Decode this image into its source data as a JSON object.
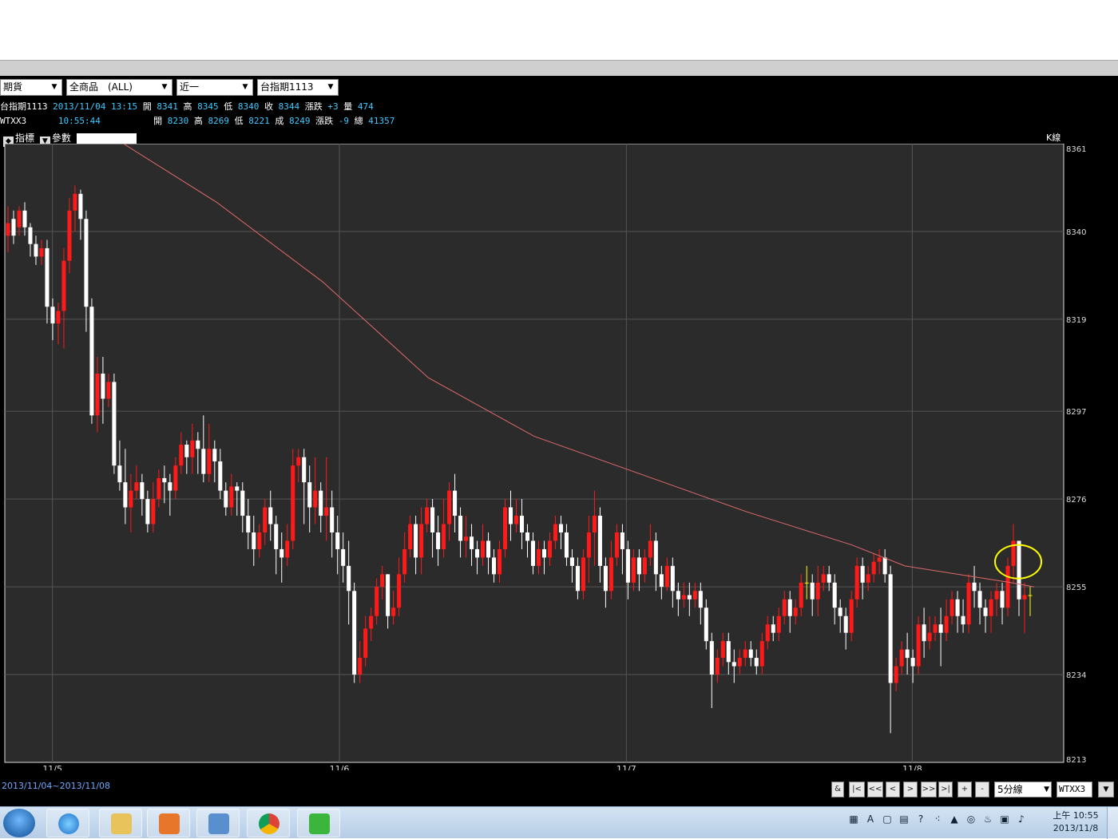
{
  "toolbar": {
    "type_select": "期貨",
    "product_select": "全商品　(ALL)",
    "month_select": "近一",
    "symbol_select": "台指期1113"
  },
  "quote1": {
    "name": "台指期1113",
    "date": "2013/11/04",
    "time": "13:15",
    "open_label": "開",
    "open": "8341",
    "high_label": "高",
    "high": "8345",
    "low_label": "低",
    "low": "8340",
    "close_label": "收",
    "close": "8344",
    "change_label": "漲跌",
    "change": "+3",
    "vol_label": "量",
    "vol": "474"
  },
  "quote2": {
    "name": "WTXX3",
    "time": "10:55:44",
    "open_label": "開",
    "open": "8230",
    "high_label": "高",
    "high": "8269",
    "low_label": "低",
    "low": "8221",
    "close_label": "成",
    "close": "8249",
    "change_label": "漲跌",
    "change": "-9",
    "vol_label": "總",
    "vol": "41357"
  },
  "indicator_bar": {
    "indicator_label": "指標",
    "params_label": "參數"
  },
  "kline_label": "K線",
  "range_label": "2013/11/04~2013/11/08",
  "nav": {
    "buttons": [
      "&",
      "|<",
      "<<",
      "<",
      ">",
      ">>",
      ">|",
      "+",
      "-"
    ]
  },
  "period_select": "5分線",
  "code_field": "WTXX3",
  "taskbar": {
    "clock_time": "上午 10:55",
    "clock_date": "2013/11/8",
    "apps": [
      "explorer",
      "ie",
      "folder",
      "media",
      "tool",
      "chrome",
      "line"
    ]
  },
  "colors": {
    "up": "#ff1a1a",
    "down": "#ffffff",
    "doji": "#ffff00",
    "ma": "#e06a6a",
    "panel": "#2b2b2b",
    "highlight": "#ffff00"
  },
  "chart_data": {
    "type": "candlestick",
    "ylim": [
      8213,
      8361
    ],
    "yticks": [
      8361,
      8340,
      8319,
      8297,
      8276,
      8255,
      8234,
      8213
    ],
    "xticks": [
      "11/5",
      "11/6",
      "11/7",
      "11/8"
    ],
    "last_close": 8253,
    "candles": [
      [
        8339,
        8342,
        8335,
        8346
      ],
      [
        8343,
        8339,
        8337,
        8345
      ],
      [
        8341,
        8345,
        8339,
        8346
      ],
      [
        8345,
        8341,
        8339,
        8347
      ],
      [
        8341,
        8337,
        8334,
        8342
      ],
      [
        8337,
        8334,
        8332,
        8339
      ],
      [
        8334,
        8336,
        8332,
        8338
      ],
      [
        8336,
        8322,
        8318,
        8338
      ],
      [
        8322,
        8318,
        8314,
        8324
      ],
      [
        8318,
        8321,
        8313,
        8323
      ],
      [
        8321,
        8333,
        8312,
        8336
      ],
      [
        8333,
        8345,
        8330,
        8348
      ],
      [
        8345,
        8349,
        8340,
        8351
      ],
      [
        8349,
        8343,
        8338,
        8350
      ],
      [
        8343,
        8322,
        8316,
        8345
      ],
      [
        8322,
        8296,
        8294,
        8324
      ],
      [
        8296,
        8306,
        8292,
        8310
      ],
      [
        8306,
        8300,
        8294,
        8310
      ],
      [
        8300,
        8304,
        8298,
        8306
      ],
      [
        8304,
        8284,
        8282,
        8306
      ],
      [
        8284,
        8280,
        8278,
        8290
      ],
      [
        8280,
        8274,
        8270,
        8288
      ],
      [
        8274,
        8278,
        8268,
        8282
      ],
      [
        8278,
        8280,
        8276,
        8284
      ],
      [
        8280,
        8276,
        8272,
        8282
      ],
      [
        8276,
        8270,
        8268,
        8278
      ],
      [
        8270,
        8276,
        8268,
        8280
      ],
      [
        8276,
        8281,
        8274,
        8283
      ],
      [
        8281,
        8280,
        8275,
        8284
      ],
      [
        8280,
        8278,
        8272,
        8282
      ],
      [
        8278,
        8284,
        8276,
        8286
      ],
      [
        8284,
        8289,
        8282,
        8292
      ],
      [
        8289,
        8286,
        8282,
        8290
      ],
      [
        8286,
        8290,
        8282,
        8294
      ],
      [
        8290,
        8288,
        8282,
        8292
      ],
      [
        8288,
        8282,
        8280,
        8296
      ],
      [
        8282,
        8288,
        8280,
        8294
      ],
      [
        8288,
        8285,
        8280,
        8290
      ],
      [
        8285,
        8278,
        8276,
        8288
      ],
      [
        8278,
        8274,
        8272,
        8280
      ],
      [
        8274,
        8279,
        8272,
        8282
      ],
      [
        8279,
        8278,
        8272,
        8280
      ],
      [
        8278,
        8272,
        8268,
        8280
      ],
      [
        8272,
        8268,
        8264,
        8276
      ],
      [
        8268,
        8264,
        8260,
        8272
      ],
      [
        8264,
        8268,
        8262,
        8270
      ],
      [
        8268,
        8274,
        8265,
        8276
      ],
      [
        8274,
        8270,
        8266,
        8278
      ],
      [
        8270,
        8264,
        8258,
        8272
      ],
      [
        8264,
        8262,
        8256,
        8268
      ],
      [
        8262,
        8266,
        8260,
        8270
      ],
      [
        8266,
        8284,
        8264,
        8288
      ],
      [
        8284,
        8286,
        8280,
        8288
      ],
      [
        8286,
        8280,
        8270,
        8288
      ],
      [
        8280,
        8274,
        8268,
        8284
      ],
      [
        8274,
        8278,
        8270,
        8286
      ],
      [
        8278,
        8272,
        8268,
        8280
      ],
      [
        8272,
        8274,
        8266,
        8286
      ],
      [
        8274,
        8268,
        8262,
        8278
      ],
      [
        8268,
        8264,
        8258,
        8272
      ],
      [
        8264,
        8260,
        8256,
        8268
      ],
      [
        8260,
        8254,
        8246,
        8266
      ],
      [
        8254,
        8234,
        8232,
        8256
      ],
      [
        8234,
        8238,
        8232,
        8242
      ],
      [
        8238,
        8245,
        8236,
        8248
      ],
      [
        8245,
        8248,
        8242,
        8250
      ],
      [
        8248,
        8255,
        8246,
        8257
      ],
      [
        8255,
        8258,
        8252,
        8260
      ],
      [
        8258,
        8248,
        8245,
        8258
      ],
      [
        8248,
        8250,
        8246,
        8254
      ],
      [
        8250,
        8258,
        8248,
        8262
      ],
      [
        8258,
        8264,
        8256,
        8268
      ],
      [
        8264,
        8270,
        8262,
        8272
      ],
      [
        8270,
        8262,
        8258,
        8272
      ],
      [
        8262,
        8270,
        8258,
        8274
      ],
      [
        8270,
        8274,
        8268,
        8276
      ],
      [
        8274,
        8268,
        8262,
        8276
      ],
      [
        8268,
        8264,
        8260,
        8272
      ],
      [
        8264,
        8270,
        8262,
        8276
      ],
      [
        8270,
        8278,
        8266,
        8280
      ],
      [
        8278,
        8272,
        8268,
        8282
      ],
      [
        8272,
        8266,
        8262,
        8274
      ],
      [
        8266,
        8267,
        8262,
        8272
      ],
      [
        8267,
        8264,
        8260,
        8270
      ],
      [
        8264,
        8262,
        8258,
        8266
      ],
      [
        8262,
        8266,
        8260,
        8270
      ],
      [
        8266,
        8262,
        8258,
        8268
      ],
      [
        8262,
        8258,
        8256,
        8264
      ],
      [
        8258,
        8264,
        8256,
        8266
      ],
      [
        8264,
        8274,
        8262,
        8276
      ],
      [
        8274,
        8270,
        8266,
        8278
      ],
      [
        8270,
        8272,
        8268,
        8276
      ],
      [
        8272,
        8268,
        8264,
        8276
      ],
      [
        8268,
        8266,
        8262,
        8270
      ],
      [
        8266,
        8260,
        8258,
        8268
      ],
      [
        8260,
        8264,
        8258,
        8266
      ],
      [
        8264,
        8262,
        8258,
        8266
      ],
      [
        8262,
        8266,
        8260,
        8268
      ],
      [
        8266,
        8270,
        8264,
        8272
      ],
      [
        8270,
        8268,
        8264,
        8272
      ],
      [
        8268,
        8262,
        8260,
        8270
      ],
      [
        8262,
        8260,
        8256,
        8264
      ],
      [
        8260,
        8254,
        8252,
        8262
      ],
      [
        8254,
        8262,
        8252,
        8264
      ],
      [
        8262,
        8268,
        8256,
        8272
      ],
      [
        8268,
        8272,
        8260,
        8278
      ],
      [
        8272,
        8260,
        8256,
        8274
      ],
      [
        8260,
        8254,
        8250,
        8262
      ],
      [
        8254,
        8262,
        8252,
        8266
      ],
      [
        8262,
        8268,
        8260,
        8270
      ],
      [
        8268,
        8264,
        8258,
        8270
      ],
      [
        8264,
        8256,
        8252,
        8266
      ],
      [
        8256,
        8262,
        8254,
        8264
      ],
      [
        8262,
        8258,
        8254,
        8264
      ],
      [
        8258,
        8262,
        8256,
        8264
      ],
      [
        8262,
        8266,
        8260,
        8270
      ],
      [
        8266,
        8258,
        8254,
        8268
      ],
      [
        8258,
        8255,
        8252,
        8260
      ],
      [
        8255,
        8260,
        8254,
        8262
      ],
      [
        8260,
        8254,
        8250,
        8262
      ],
      [
        8254,
        8252,
        8248,
        8256
      ],
      [
        8252,
        8253,
        8250,
        8256
      ],
      [
        8253,
        8252,
        8248,
        8256
      ],
      [
        8252,
        8254,
        8250,
        8256
      ],
      [
        8254,
        8250,
        8246,
        8256
      ],
      [
        8250,
        8242,
        8240,
        8252
      ],
      [
        8242,
        8234,
        8226,
        8244
      ],
      [
        8234,
        8238,
        8232,
        8240
      ],
      [
        8238,
        8242,
        8236,
        8244
      ],
      [
        8242,
        8237,
        8234,
        8244
      ],
      [
        8237,
        8236,
        8232,
        8240
      ],
      [
        8236,
        8238,
        8234,
        8240
      ],
      [
        8238,
        8240,
        8236,
        8242
      ],
      [
        8240,
        8238,
        8236,
        8242
      ],
      [
        8238,
        8236,
        8234,
        8240
      ],
      [
        8236,
        8242,
        8234,
        8244
      ],
      [
        8242,
        8246,
        8240,
        8248
      ],
      [
        8246,
        8244,
        8242,
        8248
      ],
      [
        8244,
        8248,
        8242,
        8250
      ],
      [
        8248,
        8252,
        8246,
        8254
      ],
      [
        8252,
        8248,
        8244,
        8254
      ],
      [
        8248,
        8250,
        8246,
        8252
      ],
      [
        8250,
        8256,
        8248,
        8258
      ],
      [
        8256,
        8256,
        8252,
        8260
      ],
      [
        8256,
        8252,
        8248,
        8258
      ],
      [
        8252,
        8256,
        8248,
        8260
      ],
      [
        8256,
        8258,
        8254,
        8260
      ],
      [
        8258,
        8256,
        8254,
        8260
      ],
      [
        8256,
        8250,
        8246,
        8258
      ],
      [
        8250,
        8248,
        8244,
        8252
      ],
      [
        8248,
        8244,
        8240,
        8250
      ],
      [
        8244,
        8252,
        8242,
        8254
      ],
      [
        8252,
        8260,
        8250,
        8262
      ],
      [
        8260,
        8256,
        8252,
        8262
      ],
      [
        8256,
        8258,
        8254,
        8260
      ],
      [
        8258,
        8261,
        8256,
        8263
      ],
      [
        8261,
        8262,
        8258,
        8264
      ],
      [
        8262,
        8258,
        8256,
        8264
      ],
      [
        8258,
        8232,
        8220,
        8260
      ],
      [
        8232,
        8236,
        8230,
        8238
      ],
      [
        8236,
        8240,
        8234,
        8242
      ],
      [
        8240,
        8238,
        8234,
        8244
      ],
      [
        8238,
        8236,
        8232,
        8240
      ],
      [
        8236,
        8246,
        8234,
        8248
      ],
      [
        8246,
        8242,
        8238,
        8250
      ],
      [
        8242,
        8244,
        8240,
        8248
      ],
      [
        8244,
        8246,
        8242,
        8248
      ],
      [
        8246,
        8244,
        8236,
        8250
      ],
      [
        8244,
        8248,
        8242,
        8252
      ],
      [
        8248,
        8252,
        8246,
        8254
      ],
      [
        8252,
        8248,
        8244,
        8254
      ],
      [
        8248,
        8246,
        8244,
        8252
      ],
      [
        8246,
        8256,
        8244,
        8258
      ],
      [
        8256,
        8254,
        8250,
        8260
      ],
      [
        8254,
        8250,
        8246,
        8256
      ],
      [
        8250,
        8248,
        8244,
        8252
      ],
      [
        8248,
        8252,
        8244,
        8254
      ],
      [
        8252,
        8254,
        8248,
        8256
      ],
      [
        8254,
        8250,
        8246,
        8256
      ],
      [
        8250,
        8260,
        8248,
        8262
      ],
      [
        8260,
        8266,
        8256,
        8270
      ],
      [
        8266,
        8252,
        8248,
        8266
      ],
      [
        8252,
        8253,
        8244,
        8256
      ],
      [
        8253,
        8253,
        8248,
        8255
      ]
    ],
    "ma": [
      [
        0.112,
        8361
      ],
      [
        0.2,
        8347
      ],
      [
        0.3,
        8328
      ],
      [
        0.4,
        8305
      ],
      [
        0.5,
        8291
      ],
      [
        0.6,
        8282
      ],
      [
        0.7,
        8273
      ],
      [
        0.8,
        8265
      ],
      [
        0.85,
        8260
      ],
      [
        0.9,
        8258
      ],
      [
        0.95,
        8256
      ],
      [
        0.972,
        8255
      ]
    ]
  }
}
